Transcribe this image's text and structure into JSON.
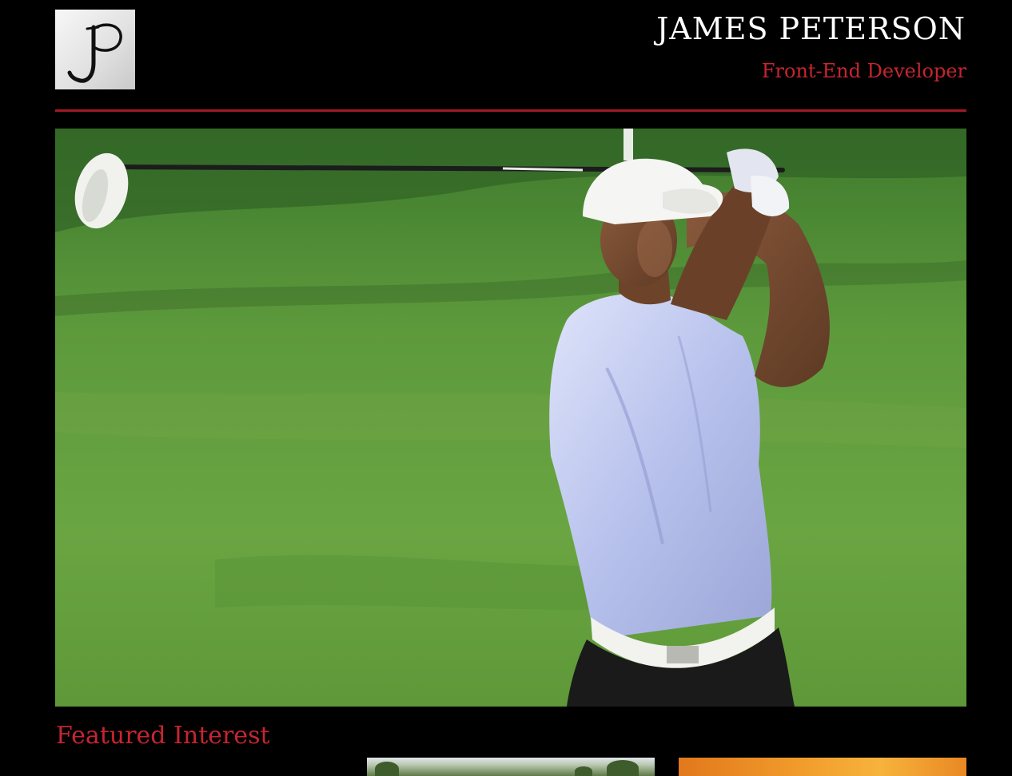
{
  "header": {
    "logo_letters": "JP",
    "name": "JAMES PETERSON",
    "role": "Front-End Developer"
  },
  "hero": {
    "subject": "golfer-follow-through-on-fairway"
  },
  "featured": {
    "title": "Featured Interest",
    "thumbnails": [
      "landscape-photo",
      "sunset-photo"
    ]
  },
  "colors": {
    "background": "#000000",
    "accent": "#c6252f",
    "rule": "#a01a24",
    "text": "#ffffff"
  }
}
